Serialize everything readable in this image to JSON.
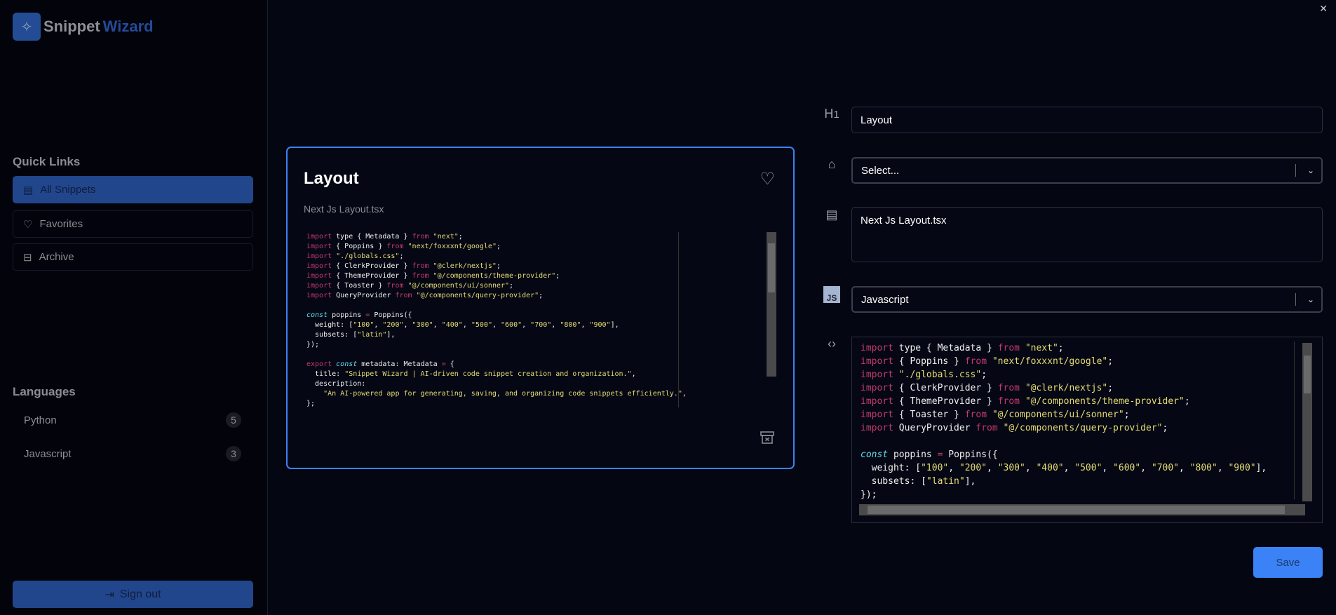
{
  "app": {
    "name_part1": "Snippet",
    "name_part2": "Wizard",
    "logo_icon": "magic-wand-icon"
  },
  "sidebar": {
    "quick_links_title": "Quick Links",
    "quick_links": [
      {
        "label": "All Snippets",
        "icon": "layout-icon",
        "active": true
      },
      {
        "label": "Favorites",
        "icon": "heart-icon"
      },
      {
        "label": "Archive",
        "icon": "archive-icon"
      }
    ],
    "languages_title": "Languages",
    "languages": [
      {
        "label": "Python",
        "count": "5"
      },
      {
        "label": "Javascript",
        "count": "3"
      }
    ],
    "sign_out": "Sign out"
  },
  "card": {
    "title": "Layout",
    "description": "Next Js Layout.tsx"
  },
  "form": {
    "title_value": "Layout",
    "tags_placeholder": "Select...",
    "description_value": "Next Js Layout.tsx",
    "language_value": "Javascript",
    "js_icon_label": "JS",
    "save": "Save"
  },
  "colors": {
    "accent": "#3b82f6",
    "sidebar_active": "#22468c",
    "keyword": "#c4386d",
    "string": "#e6db74",
    "const": "#66d9ef"
  },
  "code_lines": [
    [
      [
        "k",
        "import"
      ],
      [
        "p",
        " type { Metadata } "
      ],
      [
        "k",
        "from"
      ],
      [
        "p",
        " "
      ],
      [
        "s",
        "\"next\""
      ],
      [
        "p",
        ";"
      ]
    ],
    [
      [
        "k",
        "import"
      ],
      [
        "p",
        " { Poppins } "
      ],
      [
        "k",
        "from"
      ],
      [
        "p",
        " "
      ],
      [
        "s",
        "\"next/foxxxnt/google\""
      ],
      [
        "p",
        ";"
      ]
    ],
    [
      [
        "k",
        "import"
      ],
      [
        "p",
        " "
      ],
      [
        "s",
        "\"./globals.css\""
      ],
      [
        "p",
        ";"
      ]
    ],
    [
      [
        "k",
        "import"
      ],
      [
        "p",
        " { ClerkProvider } "
      ],
      [
        "k",
        "from"
      ],
      [
        "p",
        " "
      ],
      [
        "s",
        "\"@clerk/nextjs\""
      ],
      [
        "p",
        ";"
      ]
    ],
    [
      [
        "k",
        "import"
      ],
      [
        "p",
        " { ThemeProvider } "
      ],
      [
        "k",
        "from"
      ],
      [
        "p",
        " "
      ],
      [
        "s",
        "\"@/components/theme-provider\""
      ],
      [
        "p",
        ";"
      ]
    ],
    [
      [
        "k",
        "import"
      ],
      [
        "p",
        " { Toaster } "
      ],
      [
        "k",
        "from"
      ],
      [
        "p",
        " "
      ],
      [
        "s",
        "\"@/components/ui/sonner\""
      ],
      [
        "p",
        ";"
      ]
    ],
    [
      [
        "k",
        "import"
      ],
      [
        "p",
        " QueryProvider "
      ],
      [
        "k",
        "from"
      ],
      [
        "p",
        " "
      ],
      [
        "s",
        "\"@/components/query-provider\""
      ],
      [
        "p",
        ";"
      ]
    ],
    [
      [
        "p",
        " "
      ]
    ],
    [
      [
        "c",
        "const"
      ],
      [
        "p",
        " poppins "
      ],
      [
        "o",
        "="
      ],
      [
        "p",
        " Poppins({"
      ]
    ],
    [
      [
        "p",
        "  weight: ["
      ],
      [
        "s",
        "\"100\""
      ],
      [
        "p",
        ", "
      ],
      [
        "s",
        "\"200\""
      ],
      [
        "p",
        ", "
      ],
      [
        "s",
        "\"300\""
      ],
      [
        "p",
        ", "
      ],
      [
        "s",
        "\"400\""
      ],
      [
        "p",
        ", "
      ],
      [
        "s",
        "\"500\""
      ],
      [
        "p",
        ", "
      ],
      [
        "s",
        "\"600\""
      ],
      [
        "p",
        ", "
      ],
      [
        "s",
        "\"700\""
      ],
      [
        "p",
        ", "
      ],
      [
        "s",
        "\"800\""
      ],
      [
        "p",
        ", "
      ],
      [
        "s",
        "\"900\""
      ],
      [
        "p",
        "],"
      ]
    ],
    [
      [
        "p",
        "  subsets: ["
      ],
      [
        "s",
        "\"latin\""
      ],
      [
        "p",
        "],"
      ]
    ],
    [
      [
        "p",
        "});"
      ]
    ],
    [
      [
        "p",
        " "
      ]
    ],
    [
      [
        "k",
        "export"
      ],
      [
        "p",
        " "
      ],
      [
        "c",
        "const"
      ],
      [
        "p",
        " metadata: Metadata "
      ],
      [
        "o",
        "="
      ],
      [
        "p",
        " {"
      ]
    ],
    [
      [
        "p",
        "  title: "
      ],
      [
        "s",
        "\"Snippet Wizard | AI-driven code snippet creation and organization.\""
      ],
      [
        "p",
        ","
      ]
    ],
    [
      [
        "p",
        "  description:"
      ]
    ],
    [
      [
        "p",
        "    "
      ],
      [
        "s",
        "\"An AI-powered app for generating, saving, and organizing code snippets efficiently.\""
      ],
      [
        "p",
        ","
      ]
    ],
    [
      [
        "p",
        "};"
      ]
    ]
  ]
}
